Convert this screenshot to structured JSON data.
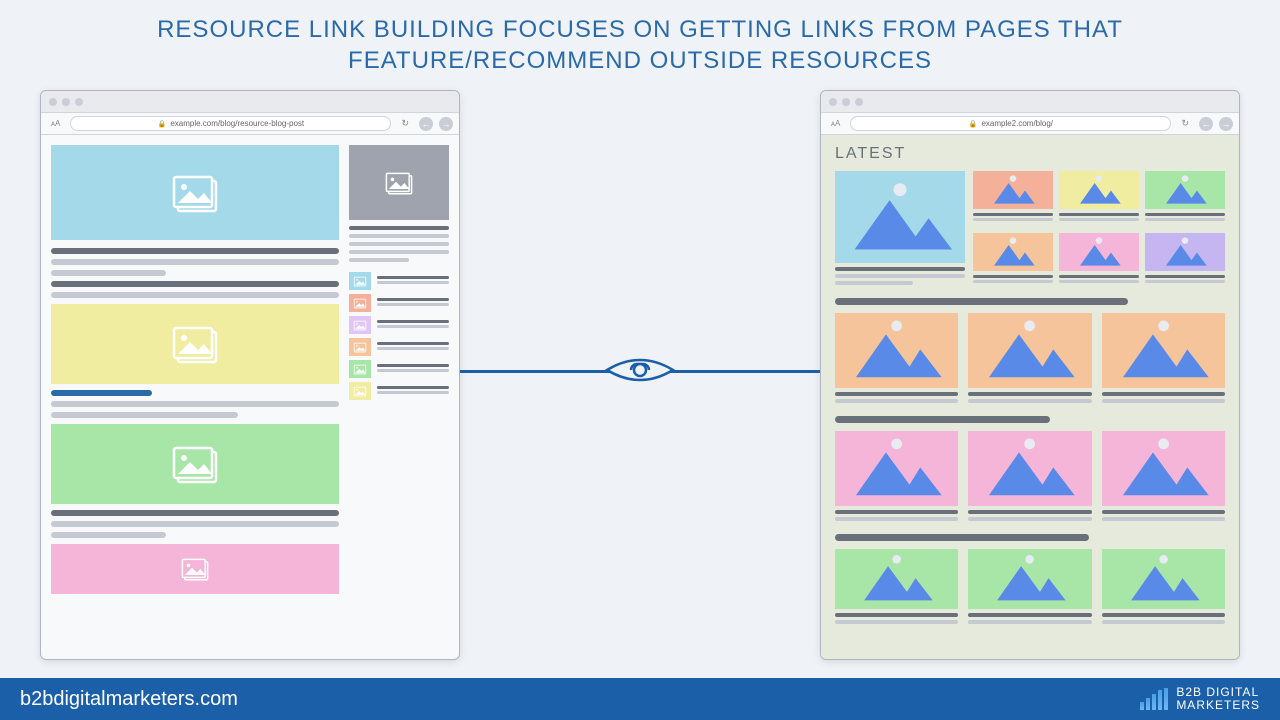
{
  "title": "RESOURCE LINK BUILDING FOCUSES ON GETTING LINKS FROM PAGES THAT FEATURE/RECOMMEND OUTSIDE RESOURCES",
  "left_browser": {
    "url": "example.com/blog/resource-blog-post"
  },
  "right_browser": {
    "url": "example2.com/blog/",
    "heading": "LATEST"
  },
  "footer": {
    "url": "b2bdigitalmarketers.com",
    "brand": "B2B DIGITAL\nMARKETERS"
  },
  "colors": {
    "cyan": "#a4d9ea",
    "yellow": "#f0eca0",
    "green": "#a8e6a8",
    "pink": "#f5b5d8",
    "coral": "#f5b09a",
    "orange": "#f5c49a",
    "violet": "#e0c5f5",
    "purple": "#c5b5f0"
  }
}
